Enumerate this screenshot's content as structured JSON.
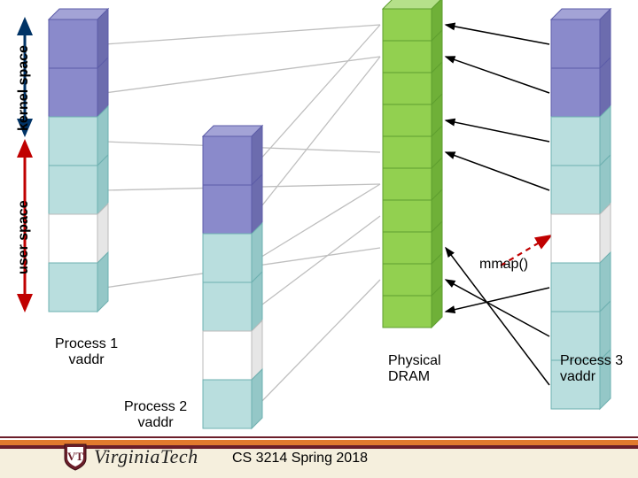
{
  "axis": {
    "kernel_label": "kernel space",
    "user_label": "user space"
  },
  "labels": {
    "mmap": "mmap()",
    "proc1": "Process 1\nvaddr",
    "proc2": "Process 2\nvaddr",
    "proc3": "Process 3\nvaddr",
    "phys": "Physical\nDRAM"
  },
  "footer": {
    "course": "CS 3214 Spring 2018",
    "logo_text": "VirginiaTech"
  },
  "colors": {
    "kernel_fill": "#8A8ACB",
    "kernel_stroke": "#5C5CA8",
    "user_fill": "#B9DEDE",
    "user_stroke": "#6DB0B0",
    "empty_fill": "#FFFFFF",
    "phys_fill": "#92D050",
    "phys_stroke": "#5E9E2F",
    "side_fill_k": "#6C6CAE",
    "side_fill_u": "#94C7C7",
    "side_fill_e": "#E6E6E6",
    "side_fill_p": "#6FB038",
    "arrow": "#000000",
    "map_line": "#BFBFBF",
    "mmap_line": "#C00000",
    "axis_kernel": "#003366",
    "axis_user": "#C00000",
    "bar_maroon": "#6B1E2A",
    "bar_orange": "#E17A2D",
    "bar_cream": "#F5EFDD"
  },
  "chart_data": {
    "type": "diagram",
    "title": "Virtual-to-physical address mapping with mmap()",
    "columns": [
      {
        "name": "Process 1 vaddr",
        "blocks": [
          "kernel",
          "kernel",
          "user",
          "user",
          "empty",
          "user"
        ]
      },
      {
        "name": "Process 2 vaddr",
        "blocks": [
          "kernel",
          "kernel",
          "user",
          "user",
          "empty",
          "user"
        ]
      },
      {
        "name": "Physical DRAM",
        "blocks": [
          "phys",
          "phys",
          "phys",
          "phys",
          "phys",
          "phys",
          "phys",
          "phys",
          "phys",
          "phys"
        ]
      },
      {
        "name": "Process 3 vaddr",
        "blocks": [
          "kernel",
          "kernel",
          "user",
          "user",
          "empty",
          "user",
          "user",
          "user"
        ]
      }
    ],
    "mappings": [
      {
        "from": "Process 1 vaddr",
        "from_block": 0,
        "to_block": 0
      },
      {
        "from": "Process 1 vaddr",
        "from_block": 1,
        "to_block": 1
      },
      {
        "from": "Process 1 vaddr",
        "from_block": 2,
        "to_block": 4
      },
      {
        "from": "Process 1 vaddr",
        "from_block": 3,
        "to_block": 5
      },
      {
        "from": "Process 1 vaddr",
        "from_block": 5,
        "to_block": 7
      },
      {
        "from": "Process 2 vaddr",
        "from_block": 0,
        "to_block": 0
      },
      {
        "from": "Process 2 vaddr",
        "from_block": 1,
        "to_block": 1
      },
      {
        "from": "Process 2 vaddr",
        "from_block": 2,
        "to_block": 5
      },
      {
        "from": "Process 2 vaddr",
        "from_block": 3,
        "to_block": 6
      },
      {
        "from": "Process 2 vaddr",
        "from_block": 5,
        "to_block": 8
      },
      {
        "from": "Process 3 vaddr",
        "from_block": 0,
        "to_block": 0
      },
      {
        "from": "Process 3 vaddr",
        "from_block": 1,
        "to_block": 1
      },
      {
        "from": "Process 3 vaddr",
        "from_block": 2,
        "to_block": 3
      },
      {
        "from": "Process 3 vaddr",
        "from_block": 3,
        "to_block": 4
      },
      {
        "from": "Process 3 vaddr",
        "from_block": 5,
        "to_block": 9
      },
      {
        "from": "Process 3 vaddr",
        "from_block": 6,
        "to_block": 8
      },
      {
        "from": "Process 3 vaddr",
        "from_block": 7,
        "to_block": 7
      }
    ],
    "mmap_mapping": {
      "from": "Process 3 vaddr",
      "from_block": 4,
      "to_block": 6
    }
  }
}
